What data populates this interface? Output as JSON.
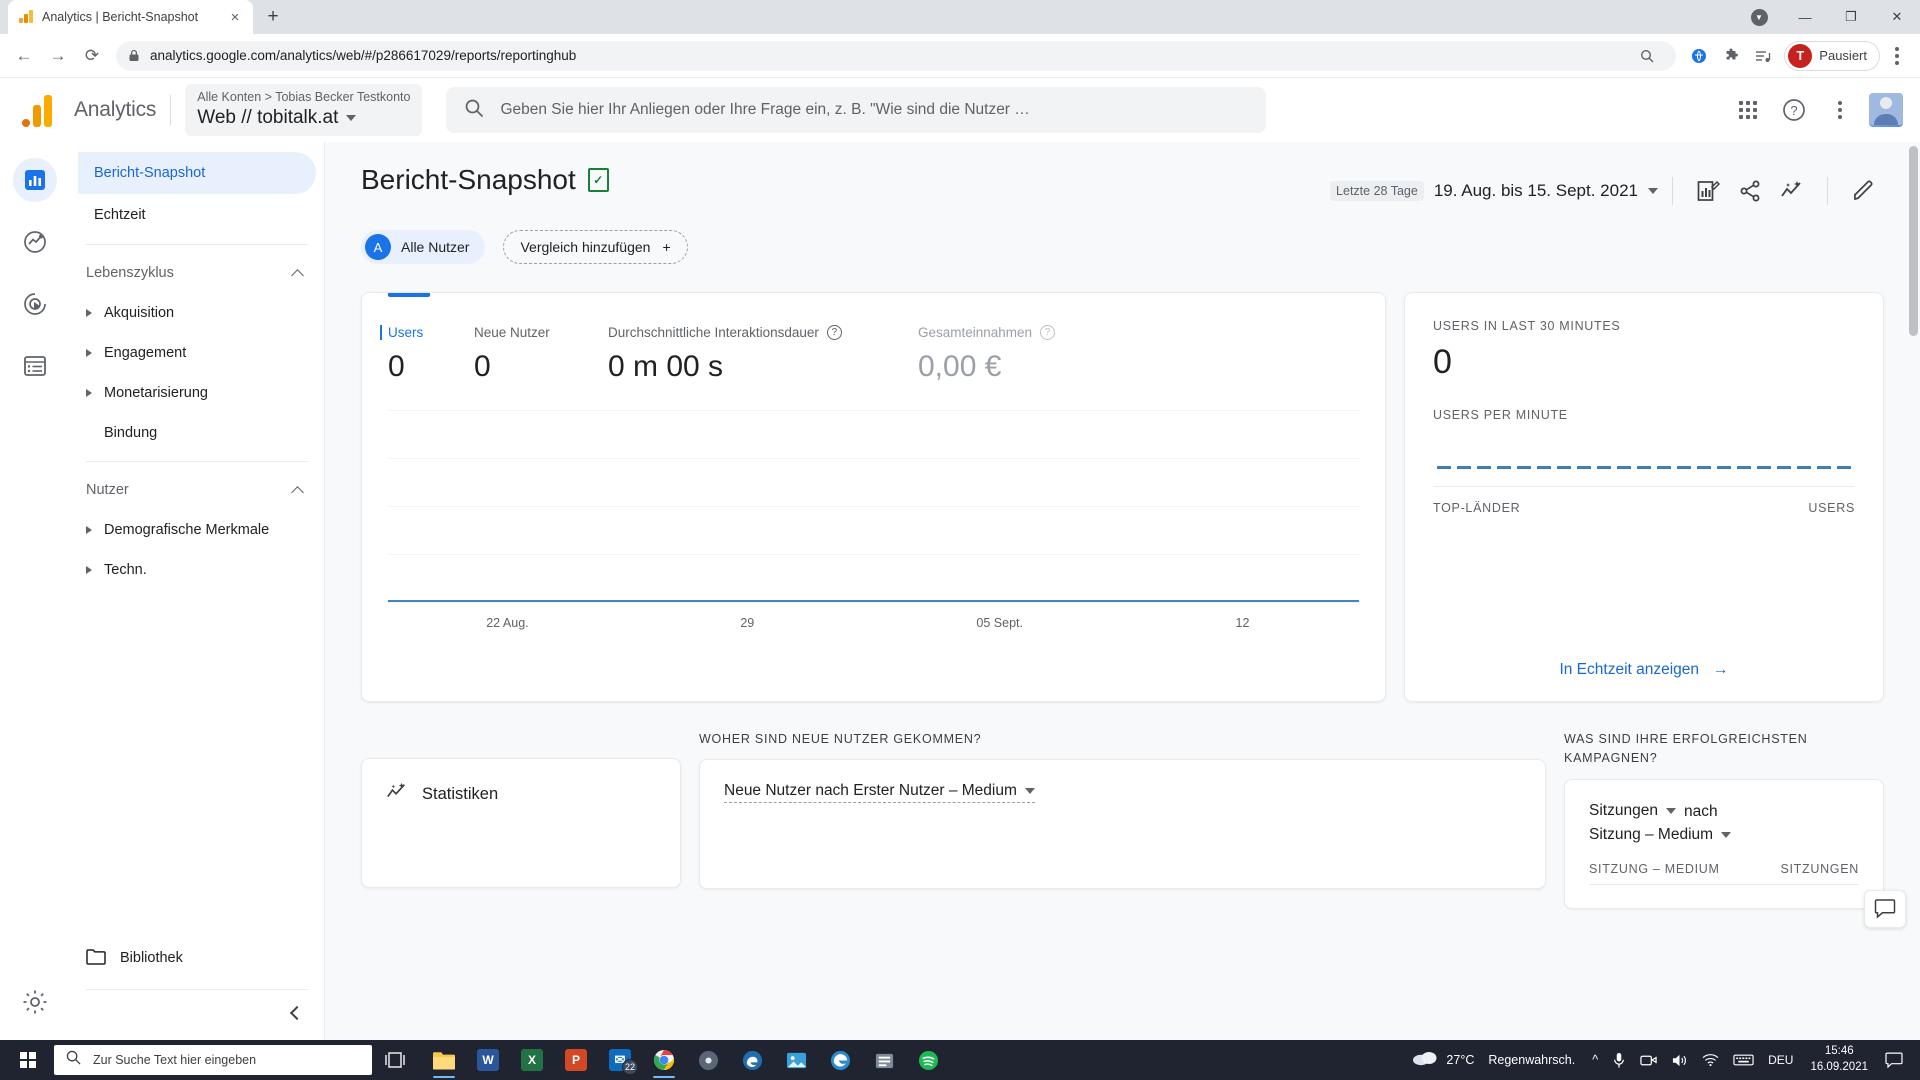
{
  "browser": {
    "tab": {
      "title": "Analytics | Bericht-Snapshot",
      "favicon": "analytics-favicon",
      "close": "×"
    },
    "new_tab_label": "+",
    "window_controls": {
      "minimize": "—",
      "maximize": "❐",
      "close": "✕",
      "profile_badge": "●"
    },
    "nav": {
      "back": "←",
      "forward": "→",
      "reload": "⟳"
    },
    "omnibox": {
      "lock_icon": "lock-icon",
      "url": "analytics.google.com/analytics/web/#/p286617029/reports/reportinghub",
      "zoom_icon": "zoom-icon",
      "star_icon": "★"
    },
    "toolbar_icons": [
      "translate-icon",
      "extensions-icon",
      "reading-list-icon"
    ],
    "profile": {
      "initial": "T",
      "label": "Pausiert"
    },
    "menu_icon": "chrome-menu-icon"
  },
  "ga_header": {
    "logo": "google-analytics-logo",
    "wordmark": "Analytics",
    "breadcrumb": "Alle Konten > Tobias Becker Testkonto",
    "property": "Web // tobitalk.at",
    "search_placeholder": "Geben Sie hier Ihr Anliegen oder Ihre Frage ein, z. B. \"Wie sind die Nutzer …",
    "icons": {
      "apps": "apps-grid-icon",
      "help": "?",
      "more": "more-vertical-icon",
      "avatar": "user-avatar"
    }
  },
  "rail": {
    "items": [
      {
        "name": "reports-icon",
        "label": "Berichte",
        "active": true
      },
      {
        "name": "explore-icon",
        "label": "Explorative Datenanalyse",
        "active": false
      },
      {
        "name": "advertising-icon",
        "label": "Werbung",
        "active": false
      },
      {
        "name": "configure-icon",
        "label": "Konfigurieren",
        "active": false
      }
    ],
    "settings_icon": "gear-icon"
  },
  "sidebar": {
    "primary": [
      {
        "label": "Bericht-Snapshot",
        "active": true
      },
      {
        "label": "Echtzeit",
        "active": false
      }
    ],
    "groups": [
      {
        "title": "Lebenszyklus",
        "expanded": true,
        "items": [
          {
            "label": "Akquisition",
            "expandable": true
          },
          {
            "label": "Engagement",
            "expandable": true
          },
          {
            "label": "Monetarisierung",
            "expandable": true
          },
          {
            "label": "Bindung",
            "expandable": false
          }
        ]
      },
      {
        "title": "Nutzer",
        "expanded": true,
        "items": [
          {
            "label": "Demografische Merkmale",
            "expandable": true
          },
          {
            "label": "Techn.",
            "expandable": true
          }
        ]
      }
    ],
    "library": {
      "label": "Bibliothek",
      "icon": "folder-icon"
    },
    "collapse_icon": "chevron-left-icon"
  },
  "page": {
    "title": "Bericht-Snapshot",
    "title_badge": "document-check-icon",
    "date_pill": "Letzte 28 Tage",
    "date_range": "19. Aug. bis 15. Sept. 2021",
    "actions": [
      {
        "name": "customize-report-icon",
        "label": "Bericht anpassen"
      },
      {
        "name": "share-icon",
        "label": "Teilen"
      },
      {
        "name": "insights-icon",
        "label": "Statistiken"
      },
      {
        "name": "edit-pencil-icon",
        "label": "Bearbeiten"
      }
    ],
    "chips": {
      "all_users_initial": "A",
      "all_users_label": "Alle Nutzer",
      "add_comparison_label": "Vergleich hinzufügen",
      "add_comparison_plus": "+"
    }
  },
  "overview_card": {
    "metrics": [
      {
        "label": "Users",
        "value": "0",
        "selected": true,
        "dim": false,
        "help": false
      },
      {
        "label": "Neue Nutzer",
        "value": "0",
        "selected": false,
        "dim": false,
        "help": false
      },
      {
        "label": "Durchschnittliche Interaktionsdauer",
        "value": "0 m 00 s",
        "selected": false,
        "dim": false,
        "help": true
      },
      {
        "label": "Gesamteinnahmen",
        "value": "0,00 €",
        "selected": false,
        "dim": true,
        "help": true
      }
    ]
  },
  "realtime_card": {
    "users_30min_label": "USERS IN LAST 30 MINUTES",
    "users_30min_value": "0",
    "users_per_minute_label": "USERS PER MINUTE",
    "top_countries_label": "TOP-LÄNDER",
    "users_col_label": "USERS",
    "link_label": "In Echtzeit anzeigen",
    "link_arrow": "→"
  },
  "sections": {
    "insights": {
      "header": "",
      "title": "Statistiken",
      "icon": "insights-sparkle-icon"
    },
    "acquisition": {
      "header": "WOHER SIND NEUE NUTZER GEKOMMEN?",
      "dimension": "Neue Nutzer nach Erster Nutzer – Medium"
    },
    "campaigns": {
      "header": "WAS SIND IHRE ERFOLGREICHSTEN KAMPAGNEN?",
      "metric_select": "Sitzungen",
      "by_word": "nach",
      "dimension_select": "Sitzung – Medium",
      "col_dimension": "SITZUNG – MEDIUM",
      "col_metric": "SITZUNGEN"
    }
  },
  "chart_data": {
    "type": "line",
    "title": "Users",
    "x": [
      "22 Aug.",
      "29",
      "05 Sept.",
      "12"
    ],
    "tick_positions_pct": [
      12.3,
      37.0,
      63.0,
      88.0
    ],
    "series": [
      {
        "name": "Users",
        "values": [
          0,
          0,
          0,
          0
        ]
      }
    ],
    "ylim": [
      0,
      1
    ],
    "xlabel": "",
    "ylabel": "",
    "grid": true,
    "gridline_count": 5,
    "line_color": "#4285c5",
    "legend": "none"
  },
  "feedback_button": {
    "icon": "feedback-icon"
  },
  "taskbar": {
    "start_icon": "windows-start-icon",
    "search_placeholder": "Zur Suche Text hier eingeben",
    "search_icon": "search-icon",
    "task_view_icon": "task-view-icon",
    "apps": [
      {
        "name": "file-explorer-icon",
        "label": "Explorer",
        "glyph": "📁",
        "color": "#f2b600",
        "running": true
      },
      {
        "name": "word-icon",
        "label": "Word",
        "glyph": "W",
        "color": "#2b579a",
        "running": false
      },
      {
        "name": "excel-icon",
        "label": "Excel",
        "glyph": "X",
        "color": "#217346",
        "running": false
      },
      {
        "name": "powerpoint-icon",
        "label": "PowerPoint",
        "glyph": "P",
        "color": "#d24726",
        "running": false
      },
      {
        "name": "mail-icon",
        "label": "Mail",
        "glyph": "✉",
        "color": "#0078d4",
        "running": false,
        "badge": "22"
      },
      {
        "name": "chrome-icon",
        "label": "Google Chrome",
        "glyph": "◉",
        "color": "#4285f4",
        "running": true
      },
      {
        "name": "disc-icon",
        "label": "Medien",
        "glyph": "◎",
        "color": "#6e7b8b",
        "running": false
      },
      {
        "name": "edge-legacy-icon",
        "label": "Browser",
        "glyph": "e",
        "color": "#1f6fb0",
        "running": false
      },
      {
        "name": "photos-icon",
        "label": "Fotos",
        "glyph": "▣",
        "color": "#3aa0d8",
        "running": false
      },
      {
        "name": "edge-icon",
        "label": "Microsoft Edge",
        "glyph": "◔",
        "color": "#2b8ccc",
        "running": false
      },
      {
        "name": "store-icon",
        "label": "Store",
        "glyph": "▤",
        "color": "#7c8a99",
        "running": false
      },
      {
        "name": "spotify-icon",
        "label": "Spotify",
        "glyph": "♫",
        "color": "#1db954",
        "running": false
      }
    ],
    "tray": {
      "weather_temp": "27°C",
      "weather_desc": "Regenwahrsch.",
      "weather_icon": "cloud-icon",
      "chevron": "^",
      "icons": [
        "microphone-icon",
        "camera-icon",
        "volume-icon",
        "wifi-icon",
        "keyboard-icon"
      ],
      "language": "DEU",
      "time": "15:46",
      "date": "16.09.2021",
      "notifications_icon": "notification-icon"
    }
  }
}
